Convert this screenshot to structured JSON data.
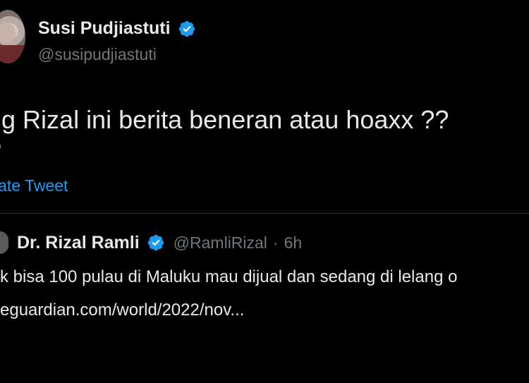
{
  "tweet": {
    "author_name": "Susi Pudjiastuti",
    "handle": "@susipudjiastuti",
    "text_line_1": "ng Rizal ini berita beneran atau hoaxx ??",
    "text_line_2": "?",
    "translate_label": "late Tweet",
    "verified_icon": "verified-badge-icon",
    "accent_color": "#1d9bf0"
  },
  "quoted_tweet": {
    "author_name": "Dr. Rizal Ramli",
    "handle": "@RamliRizal",
    "separator": "·",
    "time": "6h",
    "text": "k bisa 100 pulau di Maluku mau dijual dan sedang di lelang o",
    "link_text": "eguardian.com/world/2022/nov..."
  }
}
